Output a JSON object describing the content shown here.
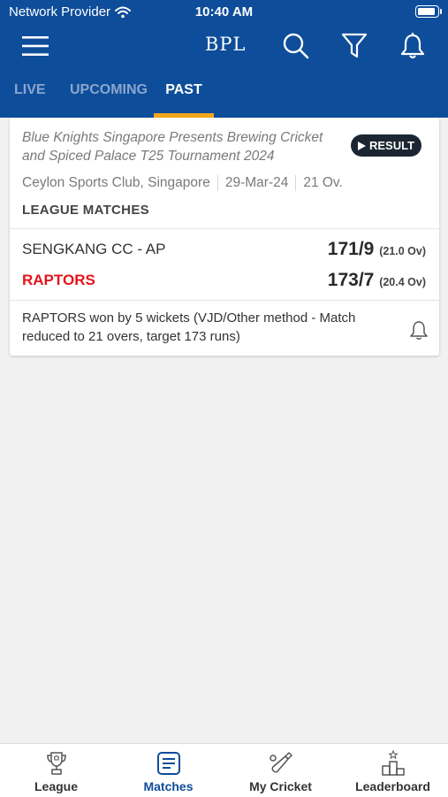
{
  "status_bar": {
    "carrier": "Network Provider",
    "time": "10:40 AM"
  },
  "header": {
    "title": "BPL"
  },
  "tabs": [
    {
      "label": "LIVE",
      "active": false
    },
    {
      "label": "UPCOMING",
      "active": false
    },
    {
      "label": "PAST",
      "active": true
    }
  ],
  "match": {
    "tournament": "Blue Knights Singapore Presents  Brewing Cricket and Spiced Palace T25 Tournament 2024",
    "status_badge": "RESULT",
    "venue": "Ceylon Sports Club, Singapore",
    "date": "29-Mar-24",
    "format": "21 Ov.",
    "stage": "LEAGUE MATCHES",
    "team1": {
      "name": "SENGKANG CC - AP",
      "score": "171/9",
      "overs": "(21.0 Ov)"
    },
    "team2": {
      "name": "RAPTORS",
      "score": "173/7",
      "overs": "(20.4 Ov)"
    },
    "summary": "RAPTORS won by 5 wickets (VJD/Other method - Match reduced to 21 overs, target 173 runs)"
  },
  "bottom_nav": [
    {
      "label": "League",
      "icon": "trophy-icon",
      "active": false
    },
    {
      "label": "Matches",
      "icon": "matches-icon",
      "active": true
    },
    {
      "label": "My Cricket",
      "icon": "cricket-bat-icon",
      "active": false
    },
    {
      "label": "Leaderboard",
      "icon": "podium-icon",
      "active": false
    }
  ],
  "colors": {
    "primary": "#0e4d9a",
    "accent": "#f2a71c",
    "winner": "#e3141b",
    "badge": "#1c2633"
  }
}
